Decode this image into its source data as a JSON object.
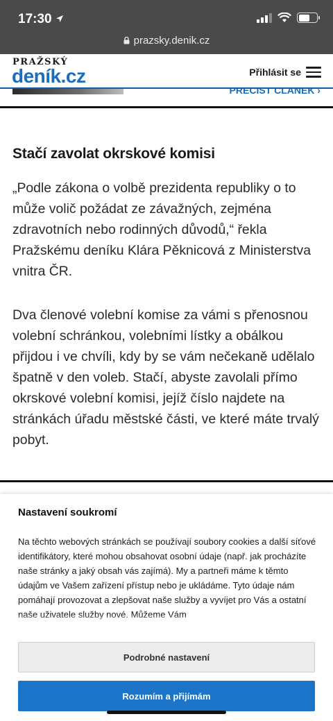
{
  "status_bar": {
    "time": "17:30",
    "url": "prazsky.denik.cz"
  },
  "header": {
    "logo_top": "PRAŽSKÝ",
    "logo_main": "deník.cz",
    "login": "Přihlásit se"
  },
  "peek": {
    "link": "PŘEČÍST ČLÁNEK ›"
  },
  "article": {
    "heading": "Stačí zavolat okrskové komisi",
    "paragraph_1": "„Podle zákona o volbě prezidenta republiky o to může volič požádat ze závažných, zejména zdravotních nebo rodinných důvodů,“ řekla Pražskému deníku Klára Pěknicová z Ministerstva vnitra ČR.",
    "paragraph_2": "Dva členové volební komise za vámi s přenosnou volební schránkou, volebními lístky a obálkou přijdou i ve chvíli, kdy by se vám nečekaně udělalo špatně v den voleb. Stačí, abyste zavolali přímo okrskové volební komisi, jejíž číslo najdete na stránkách úřadu městské části, ve které máte trvalý pobyt."
  },
  "cookie": {
    "title": "Nastavení soukromí",
    "text": "Na těchto webových stránkách se používají soubory cookies a další síťové identifikátory, které mohou obsahovat osobní údaje (např. jak procházíte naše stránky a jaký obsah vás zajímá). My a partneři máme k těmto údajům ve Vašem zařízení přístup nebo je ukládáme. Tyto údaje nám pomáhají provozovat a zlepšovat naše služby a vyvíjet pro Vás a ostatní naše uživatele služby nové. Můžeme Vám",
    "settings_button": "Podrobné nastavení",
    "accept_button": "Rozumím a přijímám"
  },
  "colors": {
    "brand": "#1a6ebd",
    "accept": "#1c74c9",
    "browser_chrome": "#4a4a4a"
  },
  "icons": [
    "location-arrow-icon",
    "signal-icon",
    "wifi-icon",
    "battery-icon",
    "lock-icon",
    "menu-icon"
  ]
}
